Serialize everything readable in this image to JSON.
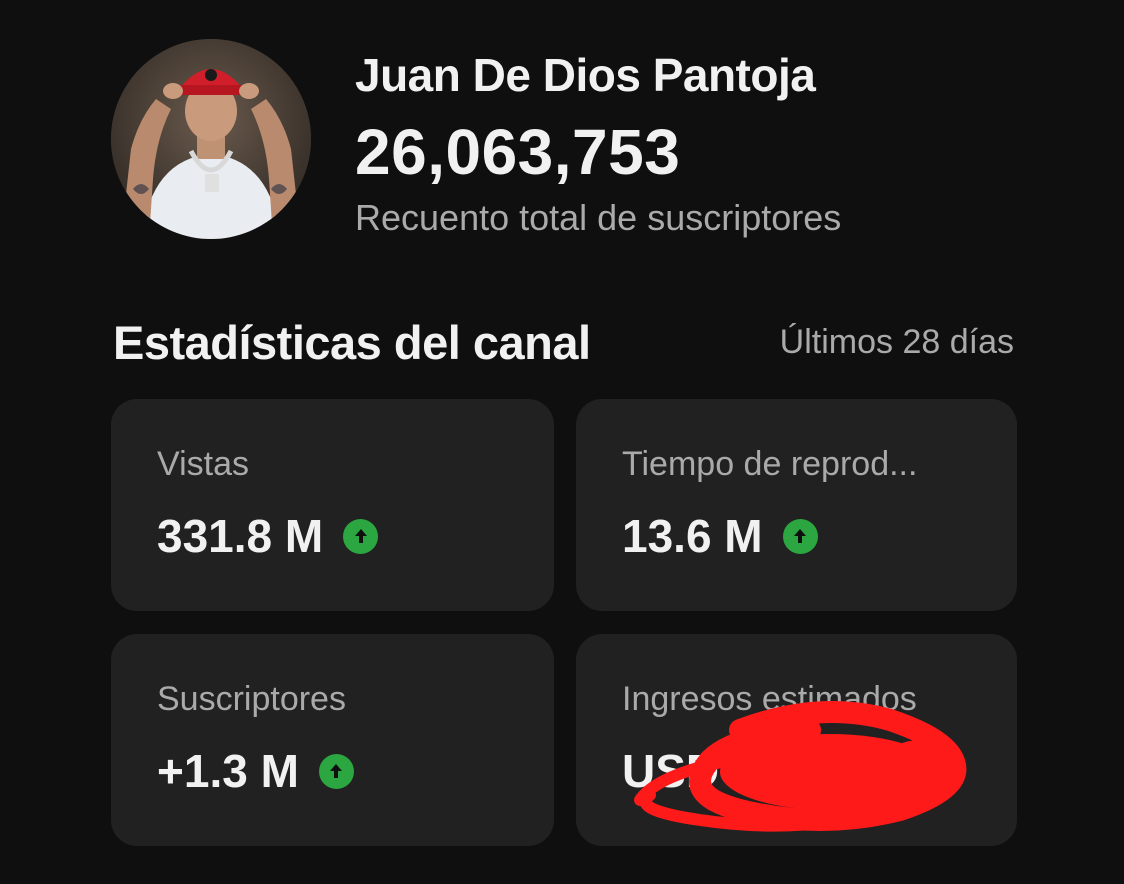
{
  "channel": {
    "name": "Juan De Dios Pantoja",
    "subscriber_total": "26,063,753",
    "subscriber_caption": "Recuento total de suscriptores"
  },
  "stats": {
    "title": "Estadísticas del canal",
    "period": "Últimos 28 días",
    "cards": [
      {
        "label": "Vistas",
        "value": "331.8 M",
        "trend": "up"
      },
      {
        "label": "Tiempo de reprod...",
        "value": "13.6 M",
        "trend": "up"
      },
      {
        "label": "Suscriptores",
        "value": "+1.3 M",
        "trend": "up"
      },
      {
        "label": "Ingresos estimados",
        "value": "USD"
      }
    ]
  },
  "colors": {
    "background": "#0f0f0f",
    "card": "#212121",
    "trend_up": "#2ba640",
    "redaction": "#ff1a1a"
  },
  "icons": {
    "trend": "arrow-up-circle-icon"
  }
}
